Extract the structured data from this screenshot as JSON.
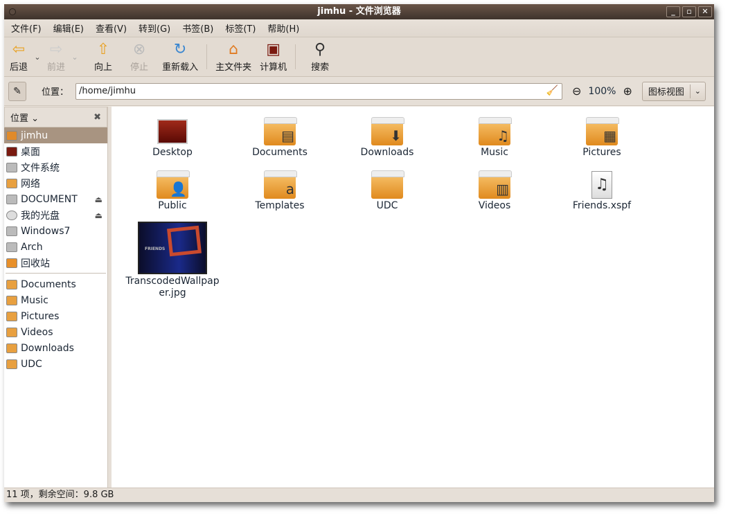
{
  "window": {
    "title": "jimhu - 文件浏览器",
    "controls": [
      "minimize",
      "maximize",
      "close"
    ]
  },
  "menu": [
    "文件(F)",
    "编辑(E)",
    "查看(V)",
    "转到(G)",
    "书签(B)",
    "标签(T)",
    "帮助(H)"
  ],
  "toolbar": {
    "back": "后退",
    "forward": "前进",
    "up": "向上",
    "stop": "停止",
    "reload": "重新载入",
    "home": "主文件夹",
    "computer": "计算机",
    "search": "搜索"
  },
  "location": {
    "label": "位置：",
    "path": "/home/jimhu",
    "zoom": "100%",
    "view": "图标视图"
  },
  "sidebar": {
    "header": "位置",
    "places": [
      {
        "label": "jimhu",
        "icon": "home-folder-icon",
        "selected": true
      },
      {
        "label": "桌面",
        "icon": "desktop-icon"
      },
      {
        "label": "文件系统",
        "icon": "drive-icon"
      },
      {
        "label": "网络",
        "icon": "network-icon"
      },
      {
        "label": "DOCUMENT",
        "icon": "drive-icon",
        "eject": true
      },
      {
        "label": "我的光盘",
        "icon": "cd-icon",
        "eject": true
      },
      {
        "label": "Windows7",
        "icon": "drive-icon"
      },
      {
        "label": "Arch",
        "icon": "drive-icon"
      },
      {
        "label": "回收站",
        "icon": "trash-icon"
      }
    ],
    "bookmarks": [
      {
        "label": "Documents",
        "icon": "documents-folder-icon"
      },
      {
        "label": "Music",
        "icon": "music-folder-icon"
      },
      {
        "label": "Pictures",
        "icon": "pictures-folder-icon"
      },
      {
        "label": "Videos",
        "icon": "videos-folder-icon"
      },
      {
        "label": "Downloads",
        "icon": "downloads-folder-icon"
      },
      {
        "label": "UDC",
        "icon": "folder-icon"
      }
    ]
  },
  "files": [
    {
      "name": "Desktop",
      "type": "desktop"
    },
    {
      "name": "Documents",
      "type": "folder",
      "emblem": "document"
    },
    {
      "name": "Downloads",
      "type": "folder",
      "emblem": "download"
    },
    {
      "name": "Music",
      "type": "folder",
      "emblem": "music"
    },
    {
      "name": "Pictures",
      "type": "folder",
      "emblem": "picture"
    },
    {
      "name": "Public",
      "type": "folder",
      "emblem": "person"
    },
    {
      "name": "Templates",
      "type": "folder",
      "emblem": "template"
    },
    {
      "name": "UDC",
      "type": "folder"
    },
    {
      "name": "Videos",
      "type": "folder",
      "emblem": "video"
    },
    {
      "name": "Friends.xspf",
      "type": "audio"
    },
    {
      "name": "TranscodedWallpaper.jpg",
      "type": "image",
      "thumb_text": "FRIENDS"
    }
  ],
  "status": "11 项，剩余空间：9.8 GB",
  "colors": {
    "titlebar": "#4f3f35",
    "selection": "#a89481",
    "folder": "#e8a040"
  }
}
